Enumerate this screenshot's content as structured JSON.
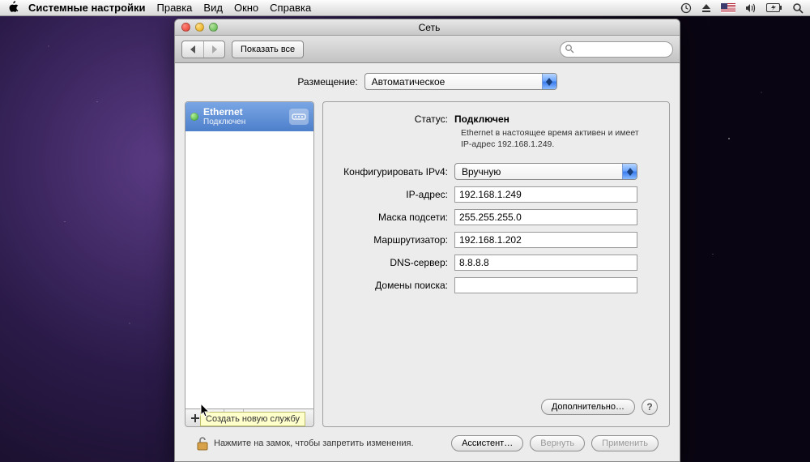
{
  "menubar": {
    "app_name": "Системные настройки",
    "items": [
      "Правка",
      "Вид",
      "Окно",
      "Справка"
    ]
  },
  "window": {
    "title": "Сеть",
    "toolbar": {
      "show_all": "Показать все",
      "search_placeholder": ""
    }
  },
  "location": {
    "label": "Размещение:",
    "value": "Автоматическое"
  },
  "sidebar": {
    "services": [
      {
        "name": "Ethernet",
        "status": "Подключен",
        "color": "#2fa52c",
        "icon": "ethernet-icon"
      }
    ],
    "tooltip": "Создать новую службу"
  },
  "detail": {
    "status_label": "Статус:",
    "status_value": "Подключен",
    "status_note": "Ethernet в настоящее время активен и имеет IP-адрес 192.168.1.249.",
    "configure_label": "Конфигурировать IPv4:",
    "configure_value": "Вручную",
    "fields": {
      "ip": {
        "label": "IP-адрес:",
        "value": "192.168.1.249"
      },
      "mask": {
        "label": "Маска подсети:",
        "value": "255.255.255.0"
      },
      "router": {
        "label": "Маршрутизатор:",
        "value": "192.168.1.202"
      },
      "dns": {
        "label": "DNS-сервер:",
        "value": "8.8.8.8"
      },
      "search": {
        "label": "Домены поиска:",
        "value": ""
      }
    },
    "advanced": "Дополнительно…"
  },
  "footer": {
    "lock_text": "Нажмите на замок, чтобы запретить изменения.",
    "assist": "Ассистент…",
    "revert": "Вернуть",
    "apply": "Применить"
  }
}
